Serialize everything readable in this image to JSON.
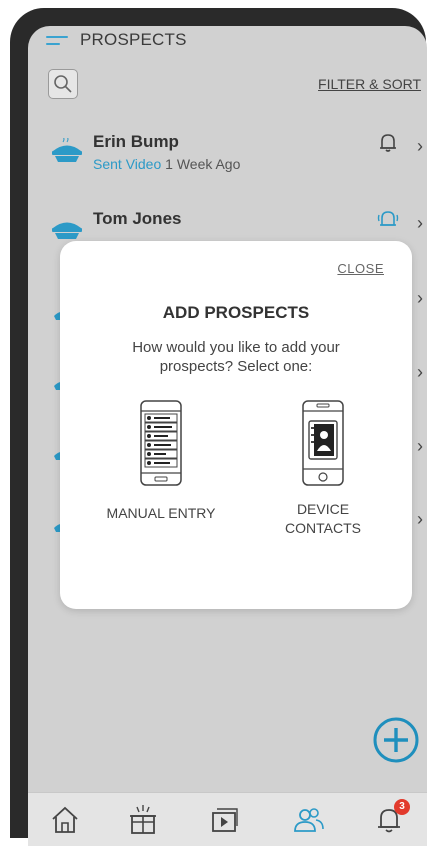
{
  "header": {
    "title": "PROSPECTS",
    "filter_label": "FILTER & SORT"
  },
  "prospects": [
    {
      "name": "Erin Bump",
      "status_highlight": "Sent Video",
      "status_rest": " 1 Week Ago",
      "bell": "bell-icon"
    },
    {
      "name": "Tom Jones",
      "status_highlight": "",
      "status_rest": "",
      "bell": "bell-active-icon"
    }
  ],
  "modal": {
    "close_label": "CLOSE",
    "title": "ADD PROSPECTS",
    "text": "How would you like to add your prospects? Select one:",
    "options": [
      {
        "label": "MANUAL ENTRY",
        "icon": "phone-list-icon"
      },
      {
        "label": "DEVICE CONTACTS",
        "icon": "phone-contacts-icon"
      }
    ]
  },
  "bottom_nav": {
    "notifications_badge": "3"
  },
  "colors": {
    "accent": "#2c9ac7",
    "overlay": "#d1d1d1",
    "badge": "#e23a2c"
  }
}
